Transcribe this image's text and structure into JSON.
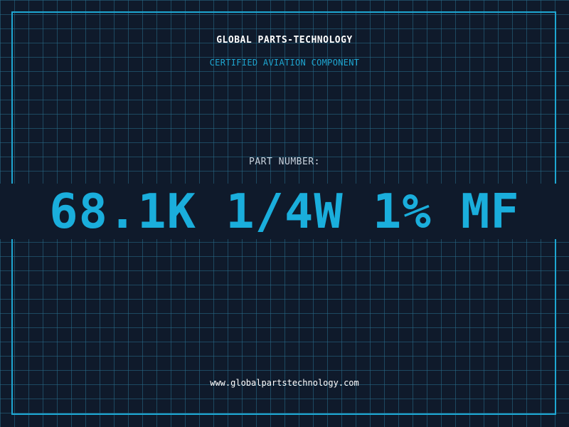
{
  "header": {
    "company_name": "GLOBAL PARTS-TECHNOLOGY",
    "subtitle": "CERTIFIED AVIATION COMPONENT"
  },
  "part": {
    "label": "PART NUMBER:",
    "number": "68.1K 1/4W 1% MF"
  },
  "footer": {
    "website": "www.globalpartstechnology.com"
  },
  "colors": {
    "background": "#0f1a2b",
    "grid": "#286e8c",
    "accent": "#1ea6d1",
    "text": "#ffffff",
    "muted_text": "#c9d3de"
  }
}
